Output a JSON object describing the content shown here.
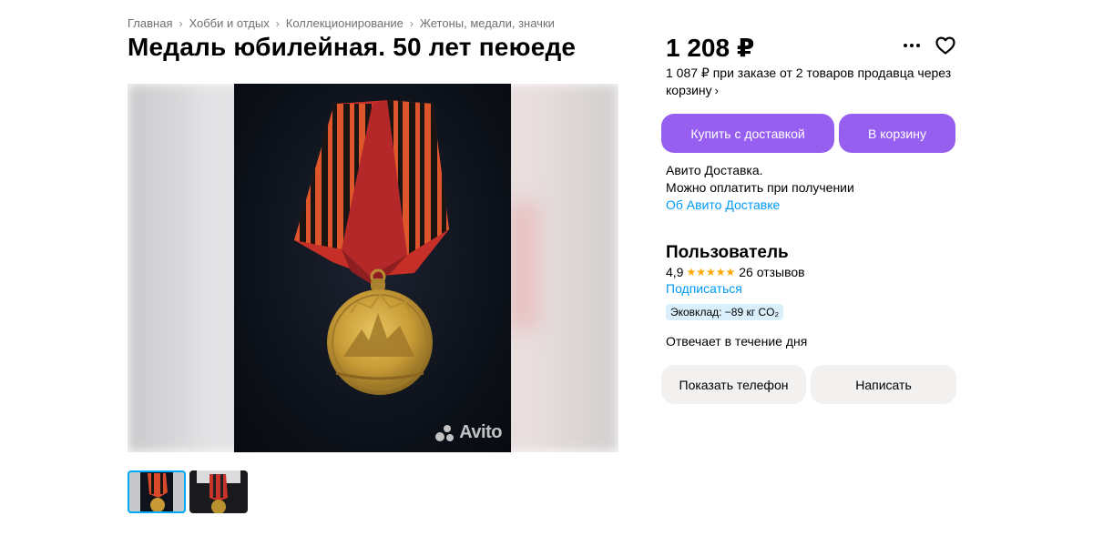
{
  "breadcrumb": [
    "Главная",
    "Хобби и отдых",
    "Коллекционирование",
    "Жетоны, медали, значки"
  ],
  "title": "Медаль юбилейная. 50 лет пеюеде",
  "gallery": {
    "watermark": "Avito"
  },
  "price": {
    "value": "1 208 ₽",
    "note": "1 087 ₽ при заказе от 2 товаров продавца через корзину"
  },
  "actions": {
    "buy_label": "Купить с доставкой",
    "cart_label": "В корзину"
  },
  "delivery": {
    "line1": "Авито Доставка.",
    "line2": "Можно оплатить при получении",
    "link": "Об Авито Доставке"
  },
  "seller": {
    "name": "Пользователь",
    "rating": "4,9",
    "stars": 5,
    "reviews": "26 отзывов",
    "subscribe": "Подписаться",
    "eco": "Эковклад: −89 кг CO₂",
    "response": "Отвечает в течение дня"
  },
  "contact": {
    "phone_label": "Показать телефон",
    "write_label": "Написать"
  },
  "colors": {
    "accent": "#975ff0",
    "link": "#0099f7",
    "star": "#ffa800",
    "eco_bg": "#d9f0fc",
    "thumb_active": "#00aaff"
  }
}
